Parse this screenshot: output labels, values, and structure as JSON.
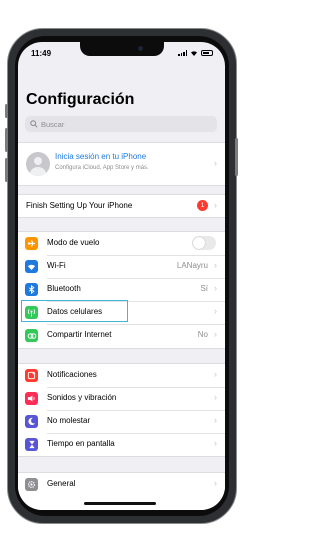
{
  "status_bar": {
    "time": "11:49"
  },
  "page": {
    "title": "Configuración"
  },
  "search": {
    "placeholder": "Buscar"
  },
  "profile": {
    "title": "Inicia sesión en tu iPhone",
    "subtitle": "Configura iCloud, App Store y más."
  },
  "setup": {
    "label": "Finish Setting Up Your iPhone",
    "badge": "1"
  },
  "connectivity": [
    {
      "label": "Modo de vuelo",
      "icon": "airplane-icon",
      "color": "#ff9500",
      "toggle": "off"
    },
    {
      "label": "Wi-Fi",
      "icon": "wifi-icon",
      "color": "#1f7ae0",
      "value": "LANayru"
    },
    {
      "label": "Bluetooth",
      "icon": "bluetooth-icon",
      "color": "#1f7ae0",
      "value": "Sí"
    },
    {
      "label": "Datos celulares",
      "icon": "cellular-icon",
      "color": "#34c759",
      "highlighted": true
    },
    {
      "label": "Compartir Internet",
      "icon": "hotspot-icon",
      "color": "#34c759",
      "value": "No"
    }
  ],
  "notifications": [
    {
      "label": "Notificaciones",
      "icon": "notifications-icon",
      "color": "#ff3b30"
    },
    {
      "label": "Sonidos y vibración",
      "icon": "sounds-icon",
      "color": "#ff2d55"
    },
    {
      "label": "No molestar",
      "icon": "moon-icon",
      "color": "#5856d6"
    },
    {
      "label": "Tiempo en pantalla",
      "icon": "hourglass-icon",
      "color": "#5856d6"
    }
  ],
  "general": {
    "label": "General",
    "icon": "gear-icon",
    "color": "#8e8e93"
  }
}
